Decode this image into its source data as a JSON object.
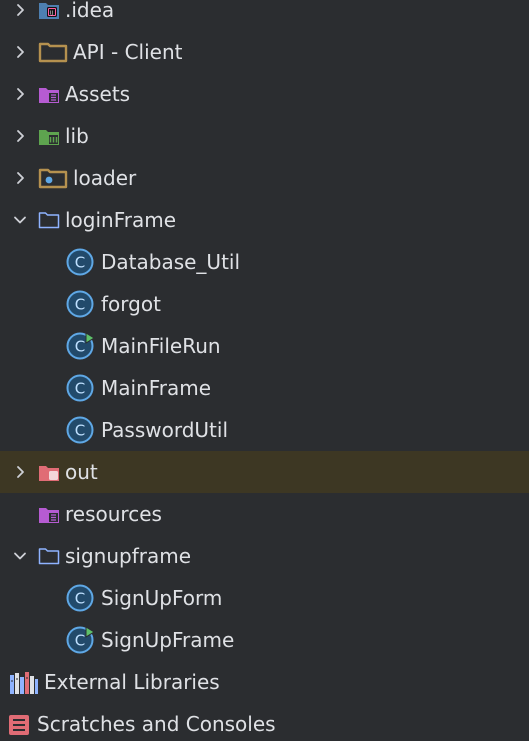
{
  "project_tree": {
    "items": [
      {
        "label": ".idea"
      },
      {
        "label": "API - Client"
      },
      {
        "label": "Assets"
      },
      {
        "label": "lib"
      },
      {
        "label": "loader"
      },
      {
        "label": "loginFrame"
      },
      {
        "label": "Database_Util",
        "icon_letter": "C"
      },
      {
        "label": "forgot",
        "icon_letter": "C"
      },
      {
        "label": "MainFileRun",
        "icon_letter": "C"
      },
      {
        "label": "MainFrame",
        "icon_letter": "C"
      },
      {
        "label": "PasswordUtil",
        "icon_letter": "C"
      },
      {
        "label": "out"
      },
      {
        "label": "resources"
      },
      {
        "label": "signupframe"
      },
      {
        "label": "SignUpForm",
        "icon_letter": "C"
      },
      {
        "label": "SignUpFrame",
        "icon_letter": "C"
      },
      {
        "label": "External Libraries"
      },
      {
        "label": "Scratches and Consoles"
      }
    ]
  },
  "colors": {
    "background": "#2b2d30",
    "highlight_row": "#3d3723",
    "text": "#dfe1e5",
    "chevron": "#ced0d6",
    "class_icon_fill": "#224a6b",
    "class_icon_stroke": "#5fa8e6",
    "folder_blue": "#8fb3ff",
    "folder_tan": "#b5914f",
    "resource_purple": "#b65bd2",
    "lib_green": "#5ea44f",
    "out_red": "#e06c75",
    "run_green": "#5ec16a"
  }
}
